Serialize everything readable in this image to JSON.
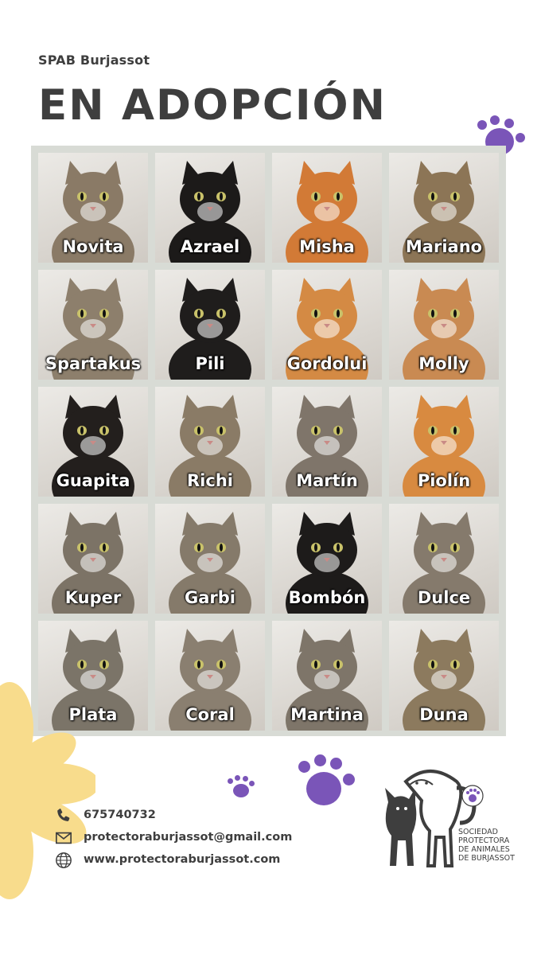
{
  "header": {
    "organization": "SPAB Burjassot",
    "title": "EN ADOPCIÓN"
  },
  "cats": [
    {
      "name": "Novita",
      "fur": "#8a7a66"
    },
    {
      "name": "Azrael",
      "fur": "#1c1a19"
    },
    {
      "name": "Misha",
      "fur": "#d27a36"
    },
    {
      "name": "Mariano",
      "fur": "#8c7556"
    },
    {
      "name": "Spartakus",
      "fur": "#8d7f6c"
    },
    {
      "name": "Pili",
      "fur": "#1f1d1c"
    },
    {
      "name": "Gordolui",
      "fur": "#d48a44"
    },
    {
      "name": "Molly",
      "fur": "#c98a52"
    },
    {
      "name": "Guapita",
      "fur": "#231f1d"
    },
    {
      "name": "Richi",
      "fur": "#8a7b66"
    },
    {
      "name": "Martín",
      "fur": "#7f756a"
    },
    {
      "name": "Piolín",
      "fur": "#d88a40"
    },
    {
      "name": "Kuper",
      "fur": "#7c7366"
    },
    {
      "name": "Garbi",
      "fur": "#857a6a"
    },
    {
      "name": "Bombón",
      "fur": "#1d1b1a"
    },
    {
      "name": "Dulce",
      "fur": "#857a6c"
    },
    {
      "name": "Plata",
      "fur": "#7b7468"
    },
    {
      "name": "Coral",
      "fur": "#8a7f70"
    },
    {
      "name": "Martina",
      "fur": "#7e7569"
    },
    {
      "name": "Duna",
      "fur": "#8c7a5e"
    }
  ],
  "contact": {
    "phone": "675740732",
    "email": "protectoraburjassot@gmail.com",
    "website": "www.protectoraburjassot.com",
    "phone_icon": "phone-icon",
    "email_icon": "envelope-icon",
    "web_icon": "globe-icon"
  },
  "logo": {
    "line1": "SOCIEDAD",
    "line2": "PROTECTORA",
    "line3": "DE ANIMALES",
    "line4": "DE BURJASSOT",
    "badge_text": "SOCIEDAD PROTECTORA DE ANIMALES DE BURJASSOT"
  },
  "colors": {
    "accent_purple": "#7a55b8",
    "flower_yellow": "#f8dc8c",
    "text_dark": "#3e3e3e",
    "grid_background": "#d8dbd5"
  }
}
